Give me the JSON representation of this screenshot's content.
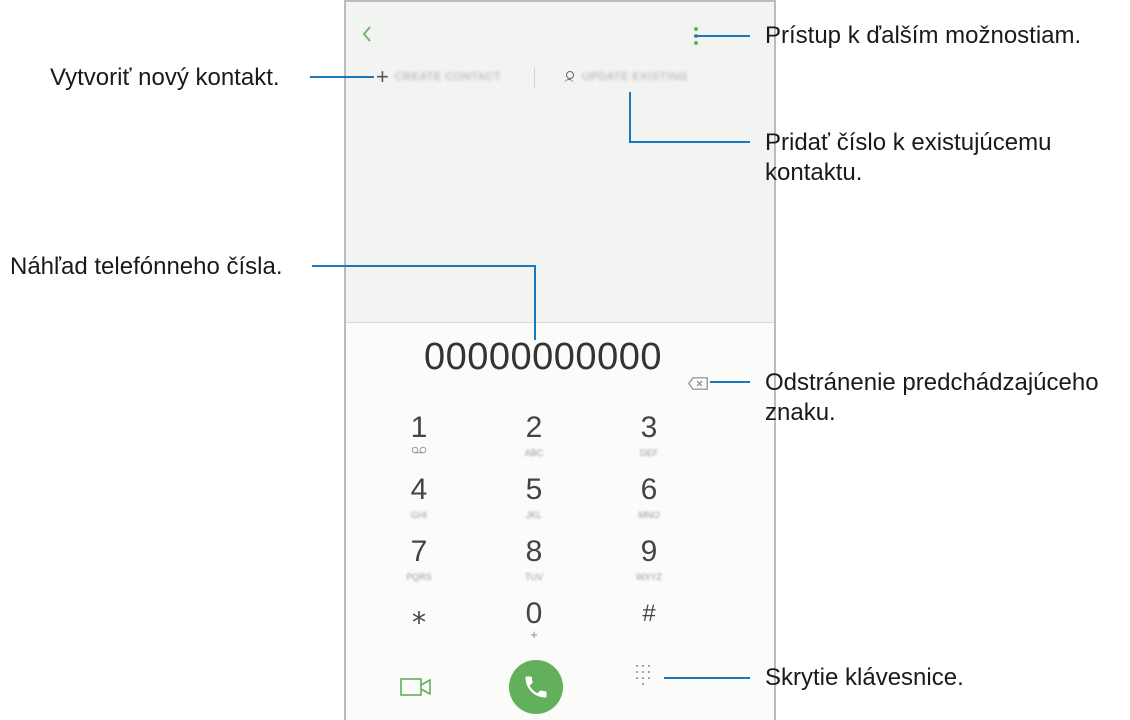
{
  "annotations": {
    "create_contact": "Vytvoriť nový kontakt.",
    "more_options": "Prístup k ďalším možnostiam.",
    "add_existing": "Pridať číslo k existujúcemu kontaktu.",
    "preview": "Náhľad telefónneho čísla.",
    "delete": "Odstránenie predchádzajúceho znaku.",
    "hide_keypad": "Skrytie klávesnice."
  },
  "actions": {
    "create": "CREATE CONTACT",
    "update": "UPDATE EXISTING"
  },
  "number": "00000000000",
  "keys": [
    {
      "digit": "1",
      "sub": ""
    },
    {
      "digit": "2",
      "sub": "ABC"
    },
    {
      "digit": "3",
      "sub": "DEF"
    },
    {
      "digit": "4",
      "sub": "GHI"
    },
    {
      "digit": "5",
      "sub": "JKL"
    },
    {
      "digit": "6",
      "sub": "MNO"
    },
    {
      "digit": "7",
      "sub": "PQRS"
    },
    {
      "digit": "8",
      "sub": "TUV"
    },
    {
      "digit": "9",
      "sub": "WXYZ"
    },
    {
      "digit": "⁎",
      "sub": ""
    },
    {
      "digit": "0",
      "sub": "+"
    },
    {
      "digit": "#",
      "sub": ""
    }
  ],
  "icons": {
    "back": "back-arrow-icon",
    "more": "more-options-icon",
    "backspace": "backspace-icon",
    "video": "video-call-icon",
    "call": "phone-call-icon",
    "keypad": "dialpad-icon"
  },
  "colors": {
    "accent": "#62b05c",
    "leader": "#1a78be"
  }
}
